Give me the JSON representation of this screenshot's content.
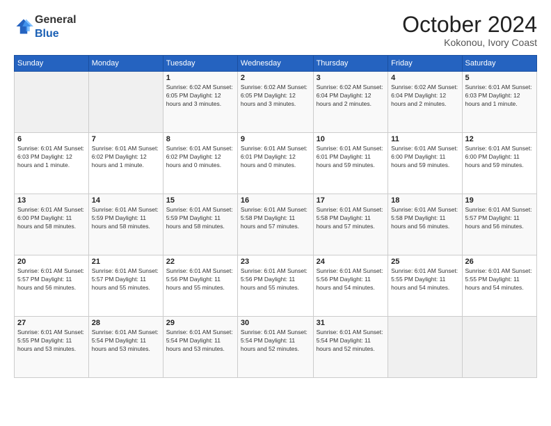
{
  "header": {
    "logo_general": "General",
    "logo_blue": "Blue",
    "month": "October 2024",
    "location": "Kokonou, Ivory Coast"
  },
  "days_of_week": [
    "Sunday",
    "Monday",
    "Tuesday",
    "Wednesday",
    "Thursday",
    "Friday",
    "Saturday"
  ],
  "weeks": [
    [
      {
        "day": "",
        "info": ""
      },
      {
        "day": "",
        "info": ""
      },
      {
        "day": "1",
        "info": "Sunrise: 6:02 AM\nSunset: 6:05 PM\nDaylight: 12 hours and 3 minutes."
      },
      {
        "day": "2",
        "info": "Sunrise: 6:02 AM\nSunset: 6:05 PM\nDaylight: 12 hours and 3 minutes."
      },
      {
        "day": "3",
        "info": "Sunrise: 6:02 AM\nSunset: 6:04 PM\nDaylight: 12 hours and 2 minutes."
      },
      {
        "day": "4",
        "info": "Sunrise: 6:02 AM\nSunset: 6:04 PM\nDaylight: 12 hours and 2 minutes."
      },
      {
        "day": "5",
        "info": "Sunrise: 6:01 AM\nSunset: 6:03 PM\nDaylight: 12 hours and 1 minute."
      }
    ],
    [
      {
        "day": "6",
        "info": "Sunrise: 6:01 AM\nSunset: 6:03 PM\nDaylight: 12 hours and 1 minute."
      },
      {
        "day": "7",
        "info": "Sunrise: 6:01 AM\nSunset: 6:02 PM\nDaylight: 12 hours and 1 minute."
      },
      {
        "day": "8",
        "info": "Sunrise: 6:01 AM\nSunset: 6:02 PM\nDaylight: 12 hours and 0 minutes."
      },
      {
        "day": "9",
        "info": "Sunrise: 6:01 AM\nSunset: 6:01 PM\nDaylight: 12 hours and 0 minutes."
      },
      {
        "day": "10",
        "info": "Sunrise: 6:01 AM\nSunset: 6:01 PM\nDaylight: 11 hours and 59 minutes."
      },
      {
        "day": "11",
        "info": "Sunrise: 6:01 AM\nSunset: 6:00 PM\nDaylight: 11 hours and 59 minutes."
      },
      {
        "day": "12",
        "info": "Sunrise: 6:01 AM\nSunset: 6:00 PM\nDaylight: 11 hours and 59 minutes."
      }
    ],
    [
      {
        "day": "13",
        "info": "Sunrise: 6:01 AM\nSunset: 6:00 PM\nDaylight: 11 hours and 58 minutes."
      },
      {
        "day": "14",
        "info": "Sunrise: 6:01 AM\nSunset: 5:59 PM\nDaylight: 11 hours and 58 minutes."
      },
      {
        "day": "15",
        "info": "Sunrise: 6:01 AM\nSunset: 5:59 PM\nDaylight: 11 hours and 58 minutes."
      },
      {
        "day": "16",
        "info": "Sunrise: 6:01 AM\nSunset: 5:58 PM\nDaylight: 11 hours and 57 minutes."
      },
      {
        "day": "17",
        "info": "Sunrise: 6:01 AM\nSunset: 5:58 PM\nDaylight: 11 hours and 57 minutes."
      },
      {
        "day": "18",
        "info": "Sunrise: 6:01 AM\nSunset: 5:58 PM\nDaylight: 11 hours and 56 minutes."
      },
      {
        "day": "19",
        "info": "Sunrise: 6:01 AM\nSunset: 5:57 PM\nDaylight: 11 hours and 56 minutes."
      }
    ],
    [
      {
        "day": "20",
        "info": "Sunrise: 6:01 AM\nSunset: 5:57 PM\nDaylight: 11 hours and 56 minutes."
      },
      {
        "day": "21",
        "info": "Sunrise: 6:01 AM\nSunset: 5:57 PM\nDaylight: 11 hours and 55 minutes."
      },
      {
        "day": "22",
        "info": "Sunrise: 6:01 AM\nSunset: 5:56 PM\nDaylight: 11 hours and 55 minutes."
      },
      {
        "day": "23",
        "info": "Sunrise: 6:01 AM\nSunset: 5:56 PM\nDaylight: 11 hours and 55 minutes."
      },
      {
        "day": "24",
        "info": "Sunrise: 6:01 AM\nSunset: 5:56 PM\nDaylight: 11 hours and 54 minutes."
      },
      {
        "day": "25",
        "info": "Sunrise: 6:01 AM\nSunset: 5:55 PM\nDaylight: 11 hours and 54 minutes."
      },
      {
        "day": "26",
        "info": "Sunrise: 6:01 AM\nSunset: 5:55 PM\nDaylight: 11 hours and 54 minutes."
      }
    ],
    [
      {
        "day": "27",
        "info": "Sunrise: 6:01 AM\nSunset: 5:55 PM\nDaylight: 11 hours and 53 minutes."
      },
      {
        "day": "28",
        "info": "Sunrise: 6:01 AM\nSunset: 5:54 PM\nDaylight: 11 hours and 53 minutes."
      },
      {
        "day": "29",
        "info": "Sunrise: 6:01 AM\nSunset: 5:54 PM\nDaylight: 11 hours and 53 minutes."
      },
      {
        "day": "30",
        "info": "Sunrise: 6:01 AM\nSunset: 5:54 PM\nDaylight: 11 hours and 52 minutes."
      },
      {
        "day": "31",
        "info": "Sunrise: 6:01 AM\nSunset: 5:54 PM\nDaylight: 11 hours and 52 minutes."
      },
      {
        "day": "",
        "info": ""
      },
      {
        "day": "",
        "info": ""
      }
    ]
  ]
}
